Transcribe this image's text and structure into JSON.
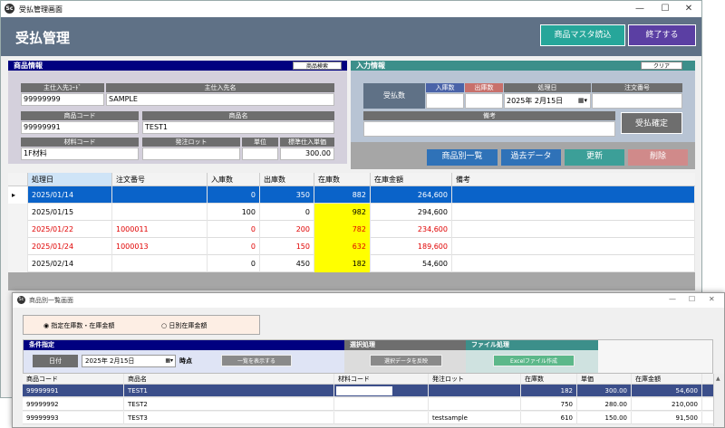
{
  "main_window": {
    "title": "受払管理画面",
    "header_title": "受払管理",
    "buttons": {
      "product_master": "商品マスタ読込",
      "exit": "終了する"
    },
    "product_info": {
      "section": "商品情報",
      "search_btn": "商品検索",
      "supplier_code_label": "主仕入先ｺｰﾄﾞ",
      "supplier_name_label": "主仕入先名",
      "supplier_code": "99999999",
      "supplier_name": "SAMPLE",
      "product_code_label": "商品コード",
      "product_name_label": "商品名",
      "product_code": "99999991",
      "product_name": "TEST1",
      "material_code_label": "材料コード",
      "order_lot_label": "発注ロット",
      "unit_label": "単位",
      "std_price_label": "標準仕入単価",
      "material_code": "1F材料",
      "order_lot": "",
      "unit": "",
      "std_price": "300.00"
    },
    "input_info": {
      "section": "入力情報",
      "clear_btn": "クリア",
      "receive_pay_label": "受払数",
      "in_qty_label": "入庫数",
      "out_qty_label": "出庫数",
      "process_date_label": "処理日",
      "order_no_label": "注文番号",
      "process_date": "2025年  2月15日",
      "note_label": "備考",
      "confirm_btn": "受払確定"
    },
    "action_buttons": {
      "by_product": "商品別一覧",
      "past_data": "過去データ",
      "update": "更新",
      "delete": "削除"
    },
    "grid": {
      "columns": [
        "処理日",
        "注文番号",
        "入庫数",
        "出庫数",
        "在庫数",
        "在庫金額",
        "備考"
      ],
      "rows": [
        {
          "date": "2025/01/14",
          "order": "",
          "in": "0",
          "out": "350",
          "stock": "882",
          "amount": "264,600",
          "note": "",
          "selected": true,
          "red": false
        },
        {
          "date": "2025/01/15",
          "order": "",
          "in": "100",
          "out": "0",
          "stock": "982",
          "amount": "294,600",
          "note": "",
          "selected": false,
          "red": false
        },
        {
          "date": "2025/01/22",
          "order": "1000011",
          "in": "0",
          "out": "200",
          "stock": "782",
          "amount": "234,600",
          "note": "",
          "selected": false,
          "red": true
        },
        {
          "date": "2025/01/24",
          "order": "1000013",
          "in": "0",
          "out": "150",
          "stock": "632",
          "amount": "189,600",
          "note": "",
          "selected": false,
          "red": true
        },
        {
          "date": "2025/02/14",
          "order": "",
          "in": "0",
          "out": "450",
          "stock": "182",
          "amount": "54,600",
          "note": "",
          "selected": false,
          "red": false
        }
      ]
    }
  },
  "sub_window": {
    "title": "商品別一覧画面",
    "radio_specified": "指定在庫数・在庫金額",
    "radio_daily": "日別在庫金額",
    "cond_section": "条件指定",
    "select_section": "選択処理",
    "file_section": "ファイル処理",
    "date_label": "日付",
    "date_value": "2025年  2月15日",
    "time_suffix": "時点",
    "show_list_btn": "一覧を表示する",
    "reflect_btn": "選択データを反映",
    "excel_btn": "Excelファイル作成",
    "columns": [
      "商品コード",
      "商品名",
      "材料コード",
      "発注ロット",
      "在庫数",
      "単価",
      "在庫金額"
    ],
    "rows": [
      {
        "code": "99999991",
        "name": "TEST1",
        "material": "",
        "lot": "",
        "stock": "182",
        "price": "300.00",
        "amount": "54,600",
        "selected": true
      },
      {
        "code": "99999992",
        "name": "TEST2",
        "material": "",
        "lot": "",
        "stock": "750",
        "price": "280.00",
        "amount": "210,000",
        "selected": false
      },
      {
        "code": "99999993",
        "name": "TEST3",
        "material": "",
        "lot": "testsample",
        "stock": "610",
        "price": "150.00",
        "amount": "91,500",
        "selected": false
      }
    ]
  },
  "colors": {
    "header": "#5f7186",
    "navy": "#000080",
    "teal": "#26a69a",
    "purple": "#5b3fa3",
    "selected": "#0a63c9",
    "red": "#e00000",
    "yellow": "#ffff00"
  }
}
